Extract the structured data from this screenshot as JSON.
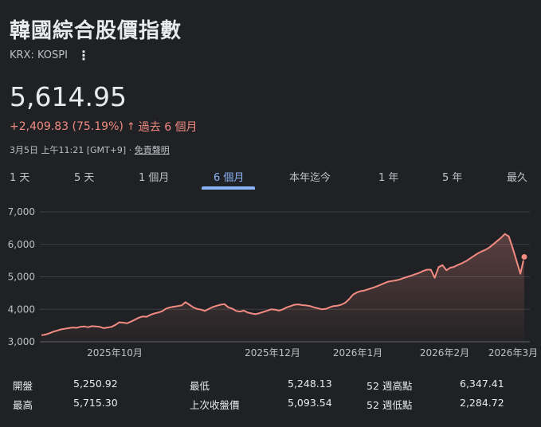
{
  "header": {
    "title": "韓國綜合股價指數",
    "ticker": "KRX: KOSPI",
    "more_icon": "more-vert-icon"
  },
  "quote": {
    "price": "5,614.95",
    "change": "+2,409.83 (75.19%)",
    "arrow": "↑",
    "period": "過去 6 個月",
    "timestamp": "3月5日 上午11:21 [GMT+9]",
    "separator": " · ",
    "disclaimer": "免責聲明"
  },
  "tabs": [
    {
      "label": "1 天",
      "active": false
    },
    {
      "label": "5 天",
      "active": false
    },
    {
      "label": "1 個月",
      "active": false
    },
    {
      "label": "6 個月",
      "active": true
    },
    {
      "label": "本年迄今",
      "active": false
    },
    {
      "label": "1 年",
      "active": false
    },
    {
      "label": "5 年",
      "active": false
    },
    {
      "label": "最久",
      "active": false
    }
  ],
  "colors": {
    "line": "#f28b82",
    "grid": "#3c4043",
    "accent_tab": "#8ab4f8",
    "background": "#202124"
  },
  "chart_data": {
    "type": "line",
    "y_ticks": [
      "7,000",
      "6,000",
      "5,000",
      "4,000",
      "3,000"
    ],
    "x_ticks": [
      "2025年10月",
      "2025年12月",
      "2026年1月",
      "2026年2月",
      "2026年3月"
    ],
    "ylim": [
      3000,
      7000
    ],
    "grid": true,
    "series": [
      {
        "values": [
          3200,
          3220,
          3260,
          3310,
          3340,
          3380,
          3400,
          3420,
          3440,
          3430,
          3460,
          3470,
          3450,
          3480,
          3470,
          3460,
          3420,
          3440,
          3460,
          3520,
          3600,
          3590,
          3570,
          3620,
          3680,
          3740,
          3780,
          3770,
          3830,
          3870,
          3900,
          3940,
          4020,
          4060,
          4080,
          4100,
          4120,
          4220,
          4140,
          4060,
          4010,
          3990,
          3950,
          4010,
          4070,
          4110,
          4140,
          4160,
          4060,
          4020,
          3950,
          3930,
          3960,
          3900,
          3870,
          3850,
          3880,
          3920,
          3960,
          4000,
          3990,
          3960,
          4000,
          4060,
          4100,
          4140,
          4150,
          4130,
          4120,
          4100,
          4060,
          4030,
          4000,
          4010,
          4060,
          4100,
          4110,
          4140,
          4200,
          4310,
          4450,
          4520,
          4560,
          4580,
          4620,
          4660,
          4700,
          4750,
          4800,
          4850,
          4870,
          4890,
          4920,
          4960,
          5000,
          5040,
          5080,
          5120,
          5180,
          5220,
          5220,
          4970,
          5300,
          5360,
          5200,
          5280,
          5310,
          5370,
          5420,
          5480,
          5560,
          5640,
          5720,
          5780,
          5830,
          5900,
          6000,
          6100,
          6200,
          6320,
          6250,
          5900,
          5500,
          5093,
          5614.95
        ]
      }
    ]
  },
  "stats": {
    "open_label": "開盤",
    "open_value": "5,250.92",
    "high_label": "最高",
    "high_value": "5,715.30",
    "low_label": "最低",
    "low_value": "5,248.13",
    "prev_close_label": "上次收盤價",
    "prev_close_value": "5,093.54",
    "wk52_high_label": "52 週高點",
    "wk52_high_value": "6,347.41",
    "wk52_low_label": "52 週低點",
    "wk52_low_value": "2,284.72"
  }
}
